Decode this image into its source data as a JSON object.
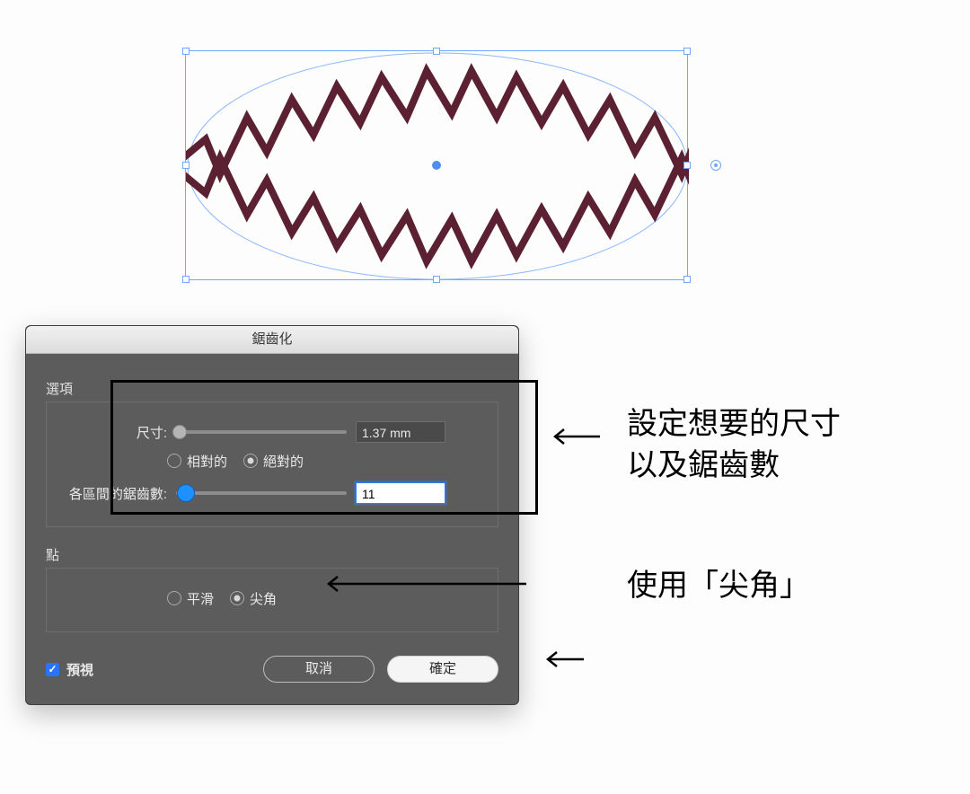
{
  "canvas": {
    "shape": "zigzag-ellipse",
    "stroke_color": "#5b2133"
  },
  "dialog": {
    "title": "鋸齒化",
    "options_title": "選項",
    "size_label": "尺寸:",
    "size_value": "1.37 mm",
    "size_slider_position_pct": 2,
    "mode": {
      "relative": "相對的",
      "absolute": "絕對的",
      "selected": "absolute"
    },
    "ridges_label": "各區間的鋸齒數:",
    "ridges_value": "11",
    "ridges_slider_position_pct": 6,
    "points_title": "點",
    "point_type": {
      "smooth": "平滑",
      "corner": "尖角",
      "selected": "corner"
    },
    "preview_label": "預視",
    "preview_checked": true,
    "cancel_label": "取消",
    "ok_label": "確定"
  },
  "annotations": {
    "size_note_line1": "設定想要的尺寸",
    "size_note_line2": "以及鋸齒數",
    "corner_note": "使用「尖角」"
  }
}
